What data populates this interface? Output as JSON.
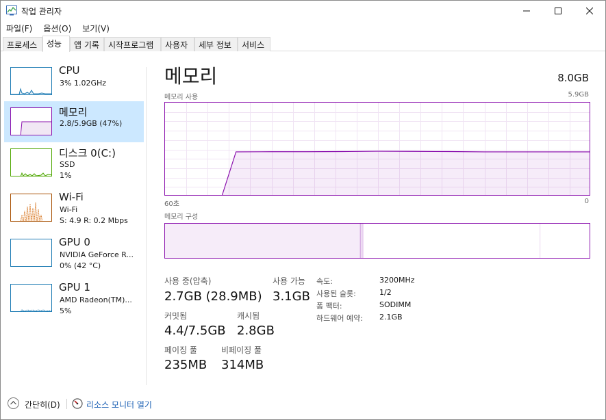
{
  "window": {
    "title": "작업 관리자"
  },
  "menu": [
    "파일(F)",
    "옵션(O)",
    "보기(V)"
  ],
  "tabs": [
    "프로세스",
    "성능",
    "앱 기록",
    "시작프로그램",
    "사용자",
    "세부 정보",
    "서비스"
  ],
  "active_tab": "성능",
  "sidebar": {
    "items": [
      {
        "name": "CPU",
        "line1": "3% 1.02GHz",
        "line2": "",
        "color": "#1b7ab3"
      },
      {
        "name": "메모리",
        "line1": "2.8/5.9GB (47%)",
        "line2": "",
        "color": "#8b12ae"
      },
      {
        "name": "디스크 0(C:)",
        "line1": "SSD",
        "line2": "1%",
        "color": "#4da600"
      },
      {
        "name": "Wi-Fi",
        "line1": "Wi-Fi",
        "line2": "S: 4.9  R: 0.2 Mbps",
        "color": "#a74f01"
      },
      {
        "name": "GPU 0",
        "line1": "NVIDIA GeForce R...",
        "line2": "0% (42 °C)",
        "color": "#1b7ab3"
      },
      {
        "name": "GPU 1",
        "line1": "AMD Radeon(TM)...",
        "line2": "5%",
        "color": "#1b7ab3"
      }
    ],
    "selected": "메모리"
  },
  "main": {
    "title": "메모리",
    "total": "8.0GB",
    "usage_label": "메모리 사용",
    "usage_max": "5.9GB",
    "axis_left": "60초",
    "axis_right": "0",
    "composition_label": "메모리 구성",
    "stats": {
      "in_use_label": "사용 중(압축)",
      "in_use_value": "2.7GB (28.9MB)",
      "available_label": "사용 가능",
      "available_value": "3.1GB",
      "committed_label": "커밋됨",
      "committed_value": "4.4/7.5GB",
      "cached_label": "캐시됨",
      "cached_value": "2.8GB",
      "paged_label": "페이징 풀",
      "paged_value": "235MB",
      "nonpaged_label": "비페이징 풀",
      "nonpaged_value": "314MB"
    },
    "details": [
      {
        "key": "속도:",
        "value": "3200MHz"
      },
      {
        "key": "사용된 슬롯:",
        "value": "1/2"
      },
      {
        "key": "폼 팩터:",
        "value": "SODIMM"
      },
      {
        "key": "하드웨어 예약:",
        "value": "2.1GB"
      }
    ]
  },
  "chart_data": {
    "type": "area",
    "x": [
      60,
      52,
      50,
      45,
      40,
      35,
      30,
      25,
      20,
      15,
      10,
      5,
      0
    ],
    "y": [
      0,
      0,
      2.8,
      2.81,
      2.81,
      2.82,
      2.84,
      2.83,
      2.82,
      2.8,
      2.8,
      2.8,
      2.8
    ],
    "xlim": [
      60,
      0
    ],
    "ylim": [
      0,
      5.9
    ],
    "composition": {
      "in_use": 2.7,
      "modified": 0.04,
      "standby": 2.45,
      "free": 0.7
    }
  },
  "footer": {
    "fewer_details": "간단히(D)",
    "resource_monitor": "리소스 모니터 열기"
  }
}
